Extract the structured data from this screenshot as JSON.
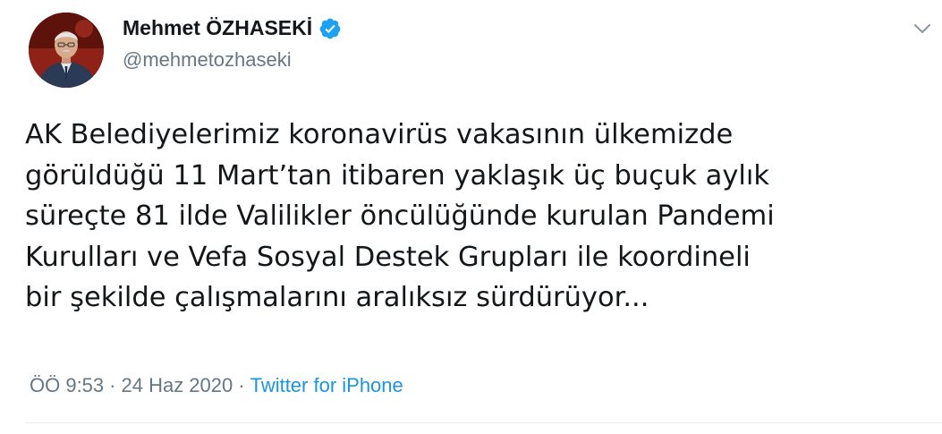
{
  "user": {
    "display_name": "Mehmet ÖZHASEKİ",
    "handle": "@mehmetozhaseki",
    "verified": true
  },
  "tweet": {
    "lines": [
      "AK Belediyelerimiz koronavirüs vakasının ülkemizde",
      "görüldüğü 11 Mart’tan itibaren yaklaşık üç buçuk aylık",
      "süreçte 81 ilde Valilikler öncülüğünde kurulan Pandemi",
      "Kurulları ve Vefa Sosyal Destek Grupları ile koordineli",
      "bir şekilde çalışmalarını aralıksız sürdürüyor..."
    ]
  },
  "meta": {
    "time": "ÖÖ 9:53",
    "separator1": "·",
    "date": "24 Haz 2020",
    "separator2": "·",
    "source": "Twitter for iPhone"
  },
  "icons": {
    "verified": "verified-badge-icon",
    "caret": "chevron-down-icon"
  },
  "colors": {
    "verified_blue": "#1da1f2",
    "link_blue": "#1b95e0",
    "secondary_text": "#657786"
  }
}
